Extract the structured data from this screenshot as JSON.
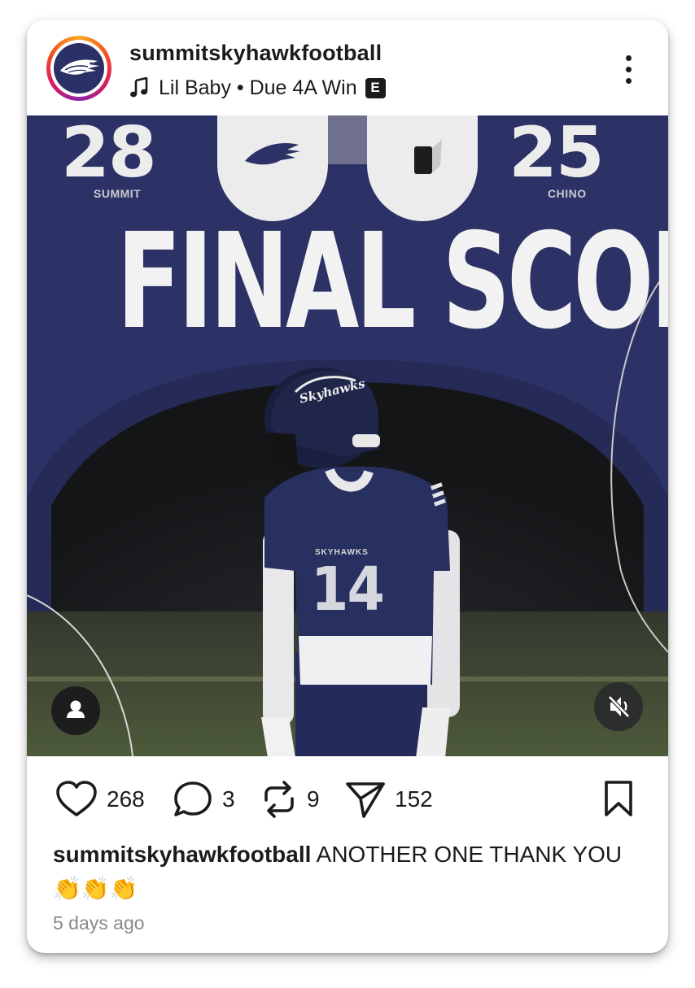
{
  "post": {
    "username": "summitskyhawkfootball",
    "audio": "Lil Baby • Due 4A Win",
    "explicit_badge": "E",
    "icons": {
      "avatar": "skyhawk-logo-icon",
      "music": "music-note-icon",
      "more": "more-vertical-icon",
      "profile_tag": "user-tag-icon",
      "mute": "speaker-muted-icon",
      "like": "heart-icon",
      "comment": "comment-bubble-icon",
      "repost": "repost-icon",
      "share": "send-icon",
      "save": "bookmark-icon"
    }
  },
  "graphic": {
    "home_score": "28",
    "home_team": "SUMMIT",
    "away_score": "25",
    "away_team": "CHINO",
    "headline": "FINAL SCORE",
    "helmet_text": "Skyhawks",
    "jersey_text": "SKYHAWKS",
    "jersey_number": "14"
  },
  "actions": {
    "likes": "268",
    "comments": "3",
    "reposts": "9",
    "shares": "152"
  },
  "caption": {
    "username": "summitskyhawkfootball",
    "text": " ANOTHER ONE THANK YOU 👏👏👏"
  },
  "timestamp": "5 days ago",
  "colors": {
    "navy": "#2d3266",
    "text": "#1b1b1b",
    "muted": "#8a8a8a"
  }
}
